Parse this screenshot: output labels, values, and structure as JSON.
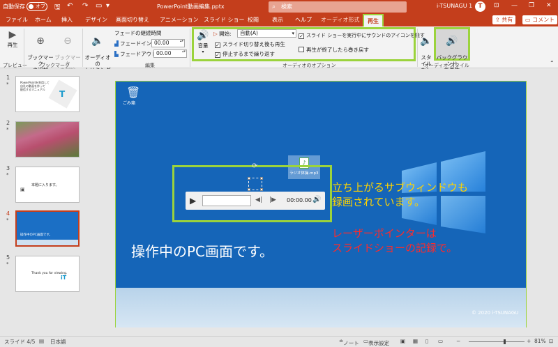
{
  "titlebar": {
    "autosave_label": "自動保存",
    "autosave_state": "オフ",
    "doc_title": "PowerPoint動画編集.pptx",
    "search_placeholder": "検索",
    "user_name": "i-TSUNAGU 1",
    "avatar_letter": "T"
  },
  "tabs": [
    {
      "label": "ファイル"
    },
    {
      "label": "ホーム"
    },
    {
      "label": "挿入"
    },
    {
      "label": "デザイン"
    },
    {
      "label": "画面切り替え"
    },
    {
      "label": "アニメーション"
    },
    {
      "label": "スライド ショー"
    },
    {
      "label": "校閲"
    },
    {
      "label": "表示"
    },
    {
      "label": "ヘルプ"
    },
    {
      "label": "オーディオ形式"
    },
    {
      "label": "再生"
    }
  ],
  "share_label": "共有",
  "comment_label": "コメント",
  "ribbon": {
    "preview": {
      "play_label": "再生",
      "group_label": "プレビュー"
    },
    "bookmark": {
      "add_label": "ブックマーク\nの追加",
      "remove_label": "ブックマーク\nの削除",
      "group_label": "ブックマーク"
    },
    "edit": {
      "trim_label": "オーディオの\nトリミング",
      "fade_title": "フェードの継続時間",
      "fade_in_label": "フェードイン:",
      "fade_in_value": "00.00",
      "fade_out_label": "フェードアウト:",
      "fade_out_value": "00.00",
      "group_label": "編集"
    },
    "audio_options": {
      "volume_label": "音量",
      "start_label": "開始:",
      "start_value": "自動(A)",
      "across_slides_label": "スライド切り替え後も再生",
      "loop_label": "停止するまで繰り返す",
      "hide_label": "スライド ショーを実行中にサウンドのアイコンを隠す",
      "rewind_label": "再生が終了したら巻き戻す",
      "group_label": "オーディオのオプション"
    },
    "audio_styles": {
      "no_style_label": "スタイル\nなし",
      "background_label": "バックグラウンド\nで再生",
      "group_label": "オーディオ スタイル"
    }
  },
  "thumbnails": [
    {
      "num": "1",
      "star": "*",
      "text": "PowerPointを利用して\n自社の動画を作って\n配信するマニュアル"
    },
    {
      "num": "2",
      "star": "*",
      "text": ""
    },
    {
      "num": "3",
      "star": "*",
      "text": "本題に入ります。"
    },
    {
      "num": "4",
      "star": "*",
      "text": "操作中のPC画面です。"
    },
    {
      "num": "5",
      "star": "*",
      "text": "Thank you for viewing."
    }
  ],
  "slide": {
    "recycle_label": "ごみ箱",
    "file_label": "ラジオ体操.mp3",
    "player_time": "00:00.00",
    "yellow_text": "立ち上がるサブウィンドウも\n録画されています。",
    "red_text": "レーザーポインターは\nスライドショーの記録で。",
    "main_text": "操作中のPC画面です。",
    "copyright": "© 2020 i-TSUNAGU"
  },
  "statusbar": {
    "slide_counter": "スライド 4/5",
    "language": "日本語",
    "notes_label": "ノート",
    "display_settings_label": "表示設定",
    "zoom": "81%"
  }
}
